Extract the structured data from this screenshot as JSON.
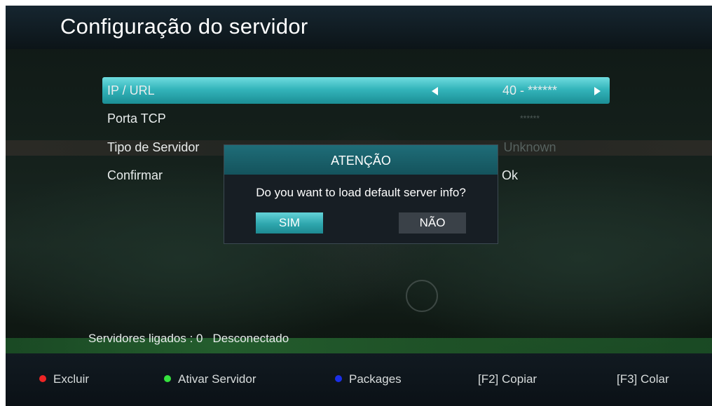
{
  "header": {
    "title": "Configuração do servidor"
  },
  "settings": [
    {
      "label": "IP / URL",
      "value": "40 - ******"
    },
    {
      "label": "Porta TCP",
      "value": "******"
    },
    {
      "label": "Tipo de Servidor",
      "value": "Unknown"
    },
    {
      "label": "Confirmar",
      "value": "Ok"
    }
  ],
  "status": {
    "label": "Servidores ligados : 0",
    "state": "Desconectado"
  },
  "dialog": {
    "title": "ATENÇÃO",
    "message": "Do you want to load default server info?",
    "yes_label": "SIM",
    "no_label": "NÃO"
  },
  "footer": {
    "delete_label": "Excluir",
    "activate_label": "Ativar Servidor",
    "packages_label": "Packages",
    "copy_label": "[F2]  Copiar",
    "paste_label": "[F3]  Colar"
  },
  "colors": {
    "accent": "#34b5bb",
    "red_key": "#ee2525",
    "green_key": "#35e23e",
    "blue_key": "#1b2fe8"
  }
}
